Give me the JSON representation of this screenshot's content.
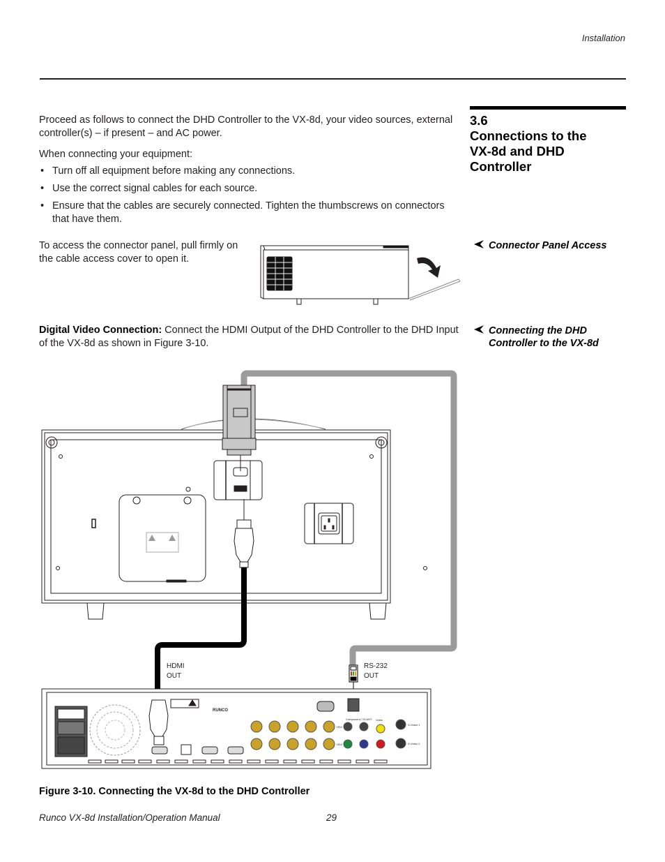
{
  "header": {
    "section_label": "Installation"
  },
  "section": {
    "number": "3.6",
    "title_lines": [
      "Connections to the",
      "VX-8d and DHD",
      "Controller"
    ]
  },
  "intro": {
    "paragraph": "Proceed as follows to connect the DHD Controller to the VX-8d, your video sources, external controller(s) – if present – and AC power.",
    "lead_in": "When connecting your equipment:",
    "bullets": [
      "Turn off all equipment before making any connections.",
      "Use the correct signal cables for each source.",
      "Ensure that the cables are securely connected. Tighten the thumbscrews on connectors that have them."
    ],
    "bullet_glyph": "•"
  },
  "connector_panel": {
    "sidenote": "Connector Panel Access",
    "text": "To access the connector panel, pull firmly on the cable access cover to open it."
  },
  "digital_video": {
    "sidenote": "Connecting the DHD Controller to the VX-8d",
    "lead_bold": "Digital Video Connection:",
    "text": " Connect the HDMI Output of the DHD Controller to the DHD Input of the VX-8d as shown in Figure 3-10."
  },
  "figure": {
    "caption": "Figure 3-10. Connecting the VX-8d to the DHD Controller",
    "labels": {
      "hdmi_out": [
        "HDMI",
        "OUT"
      ],
      "rs232_out": [
        "RS-232",
        "OUT"
      ],
      "brand": "RUNCO",
      "component_scart": "Component / SCART",
      "hd1": "HD1",
      "hd2": "HD2",
      "video": "Video",
      "svideo1": "S-Video 1",
      "svideo2": "S-Video 2"
    },
    "colors": {
      "rs232_cable": "#9b9b9b",
      "hdmi_cable": "#000000",
      "bnc_gold": "#c9a227",
      "rca_yellow": "#f2e100",
      "rca_green": "#1a8a3c",
      "rca_blue": "#2b3990",
      "rca_red": "#d7191c"
    }
  },
  "sidenote_arrow": "➤",
  "footer": {
    "manual_title": "Runco VX-8d Installation/Operation Manual",
    "page_number": "29"
  }
}
